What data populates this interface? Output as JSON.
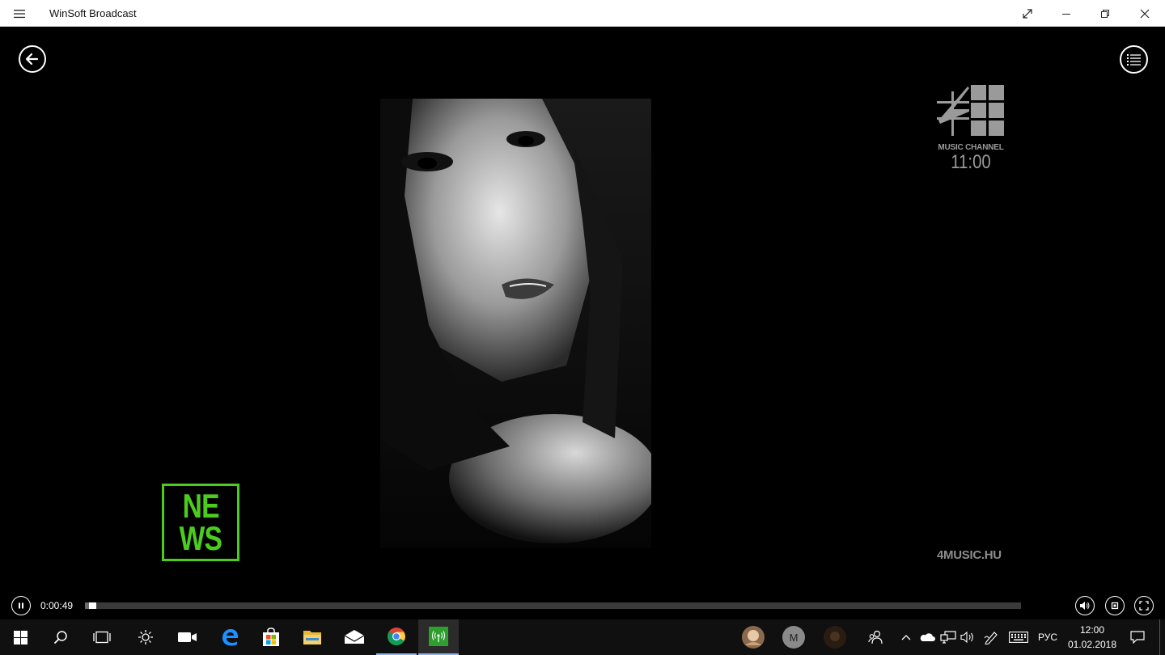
{
  "window": {
    "title": "WinSoft Broadcast",
    "menu_icon": "hamburger-icon",
    "buttons": [
      "expand-icon",
      "minimize-icon",
      "restore-icon",
      "close-icon"
    ]
  },
  "video": {
    "back_icon": "back-arrow-icon",
    "playlist_icon": "list-icon",
    "channel_logo": {
      "subtitle": "MUSIC CHANNEL",
      "time": "11:00"
    },
    "news_badge": {
      "line1": "NE",
      "line2": "WS"
    },
    "site_watermark": "4MUSIC.HU"
  },
  "player": {
    "state": "playing",
    "elapsed": "0:00:49",
    "progress_fraction": 0.004,
    "right_icons": [
      "volume-icon",
      "aspect-ratio-icon",
      "fullscreen-icon"
    ]
  },
  "taskbar": {
    "pinned": [
      {
        "name": "start",
        "icon": "windows-icon"
      },
      {
        "name": "search",
        "icon": "search-icon"
      },
      {
        "name": "task-view",
        "icon": "task-view-icon"
      },
      {
        "name": "settings-app",
        "icon": "sun-icon"
      },
      {
        "name": "camera",
        "icon": "camera-icon"
      },
      {
        "name": "edge",
        "icon": "edge-icon"
      },
      {
        "name": "store",
        "icon": "store-icon"
      },
      {
        "name": "file-explorer",
        "icon": "folder-icon"
      },
      {
        "name": "mail",
        "icon": "mail-icon"
      },
      {
        "name": "chrome",
        "icon": "chrome-icon"
      },
      {
        "name": "winsoft-broadcast",
        "icon": "broadcast-icon"
      }
    ],
    "people_avatar_letter": "M",
    "language": "РУС",
    "time": "12:00",
    "date": "01.02.2018",
    "colors": {
      "news_green": "#4ccd1e",
      "taskbar_bg": "#101010",
      "active_underline": "#8ab4f8"
    }
  }
}
